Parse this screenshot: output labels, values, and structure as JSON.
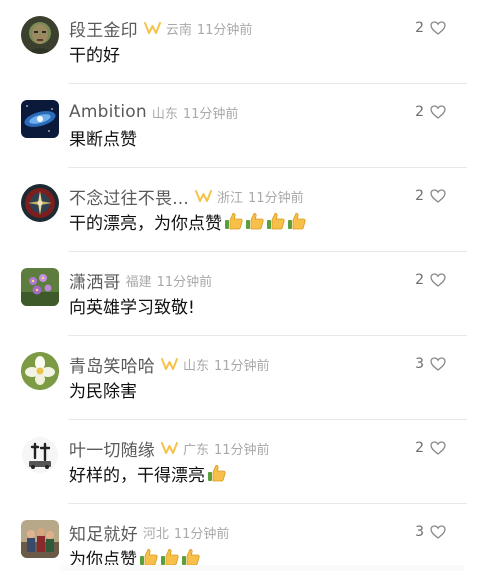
{
  "comments": [
    {
      "username": "段王金印",
      "vip": true,
      "location": "云南",
      "time": "11分钟前",
      "text": "干的好",
      "thumbs": 0,
      "likes": "2",
      "avatar_icon": "portrait-face-avatar-icon"
    },
    {
      "username": "Ambition",
      "vip": false,
      "location": "山东",
      "time": "11分钟前",
      "text": "果断点赞",
      "thumbs": 0,
      "likes": "2",
      "avatar_icon": "galaxy-avatar-icon"
    },
    {
      "username": "不念过往不畏...",
      "vip": true,
      "location": "浙江",
      "time": "11分钟前",
      "text": "干的漂亮，为你点赞",
      "thumbs": 4,
      "likes": "2",
      "avatar_icon": "compass-emblem-avatar-icon"
    },
    {
      "username": "潇洒哥",
      "vip": false,
      "location": "福建",
      "time": "11分钟前",
      "text": "向英雄学习致敬!",
      "thumbs": 0,
      "likes": "2",
      "avatar_icon": "purple-flowers-avatar-icon"
    },
    {
      "username": "青岛笑哈哈",
      "vip": true,
      "location": "山东",
      "time": "11分钟前",
      "text": "为民除害",
      "thumbs": 0,
      "likes": "3",
      "avatar_icon": "white-flower-avatar-icon"
    },
    {
      "username": "叶一切随缘",
      "vip": true,
      "location": "广东",
      "time": "11分钟前",
      "text": "好样的，干得漂亮",
      "thumbs": 1,
      "likes": "2",
      "avatar_icon": "calligraphy-avatar-icon"
    },
    {
      "username": "知足就好",
      "vip": false,
      "location": "河北",
      "time": "11分钟前",
      "text": "为你点赞",
      "thumbs": 3,
      "likes": "3",
      "avatar_icon": "family-photo-avatar-icon"
    }
  ],
  "colors": {
    "username": "#5a5a5a",
    "meta": "#a9a9a9",
    "text": "#111111",
    "vip_badge": "#f5c24b",
    "heart": "#888888"
  },
  "icons": {
    "vip_badge": "vip-badge-icon",
    "like": "heart-outline-icon",
    "thumbs_up": "thumbs-up-emoji-icon"
  }
}
